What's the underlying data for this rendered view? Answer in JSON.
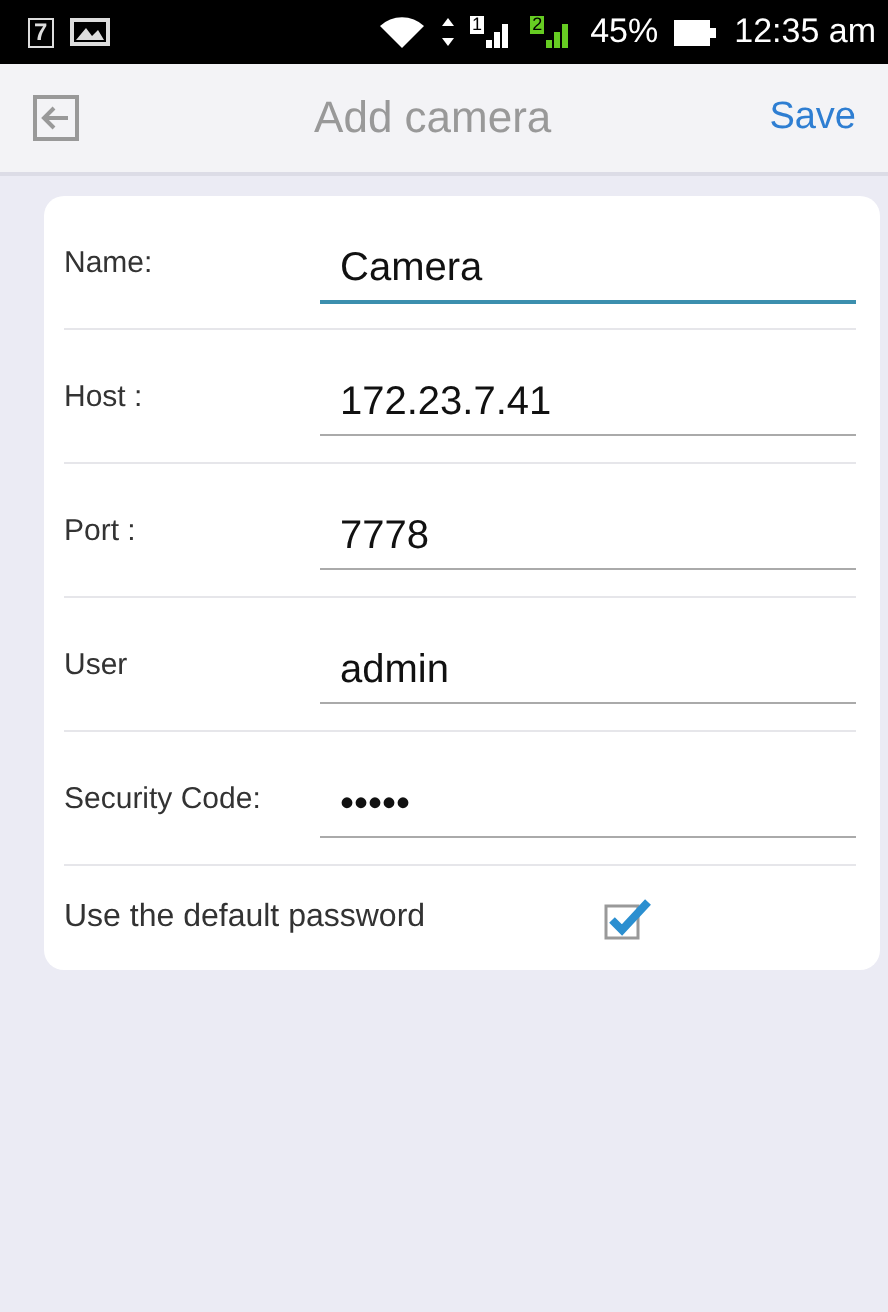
{
  "status_bar": {
    "notification_badge": "7",
    "sim_1": "1",
    "sim_2": "2",
    "battery": "45%",
    "time": "12:35 am"
  },
  "app_bar": {
    "title": "Add camera",
    "action": "Save"
  },
  "form": {
    "fields": [
      {
        "label": "Name:",
        "value": "Camera",
        "focused": true
      },
      {
        "label": "Host :",
        "value": "172.23.7.41",
        "focused": false
      },
      {
        "label": "Port :",
        "value": "7778",
        "focused": false
      },
      {
        "label": "User",
        "value": "admin",
        "focused": false
      },
      {
        "label": "Security Code:",
        "value": "•••••",
        "focused": false
      }
    ],
    "checkbox": {
      "label": "Use the default password",
      "checked": true
    }
  }
}
